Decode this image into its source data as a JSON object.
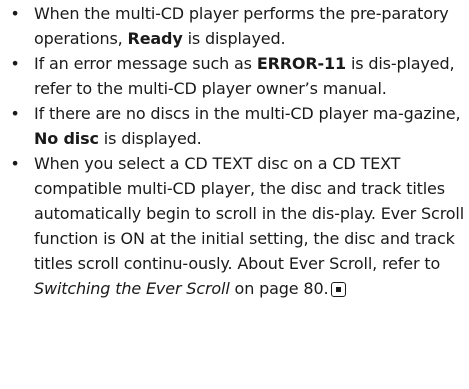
{
  "bullet_char": "•",
  "items": [
    {
      "pre": "When the multi-CD player performs the pre-paratory operations, ",
      "bold": "Ready",
      "post": " is displayed."
    },
    {
      "pre": "If an error message such as ",
      "bold": "ERROR-11",
      "post": " is dis-played, refer to the multi-CD player owner’s manual."
    },
    {
      "pre": "If there are no discs in the multi-CD player ma-gazine, ",
      "bold": "No disc",
      "post": " is displayed."
    },
    {
      "pre": "When you select a CD TEXT disc on a CD TEXT compatible multi-CD player, the disc and track titles automatically begin to scroll in the dis-play. Ever Scroll function is ON at the initial setting, the disc and track titles scroll continu-ously. About Ever Scroll, refer to ",
      "italic": "Switching the Ever Scroll",
      "post": " on page 80."
    }
  ],
  "end_icon": "end-of-section-icon"
}
